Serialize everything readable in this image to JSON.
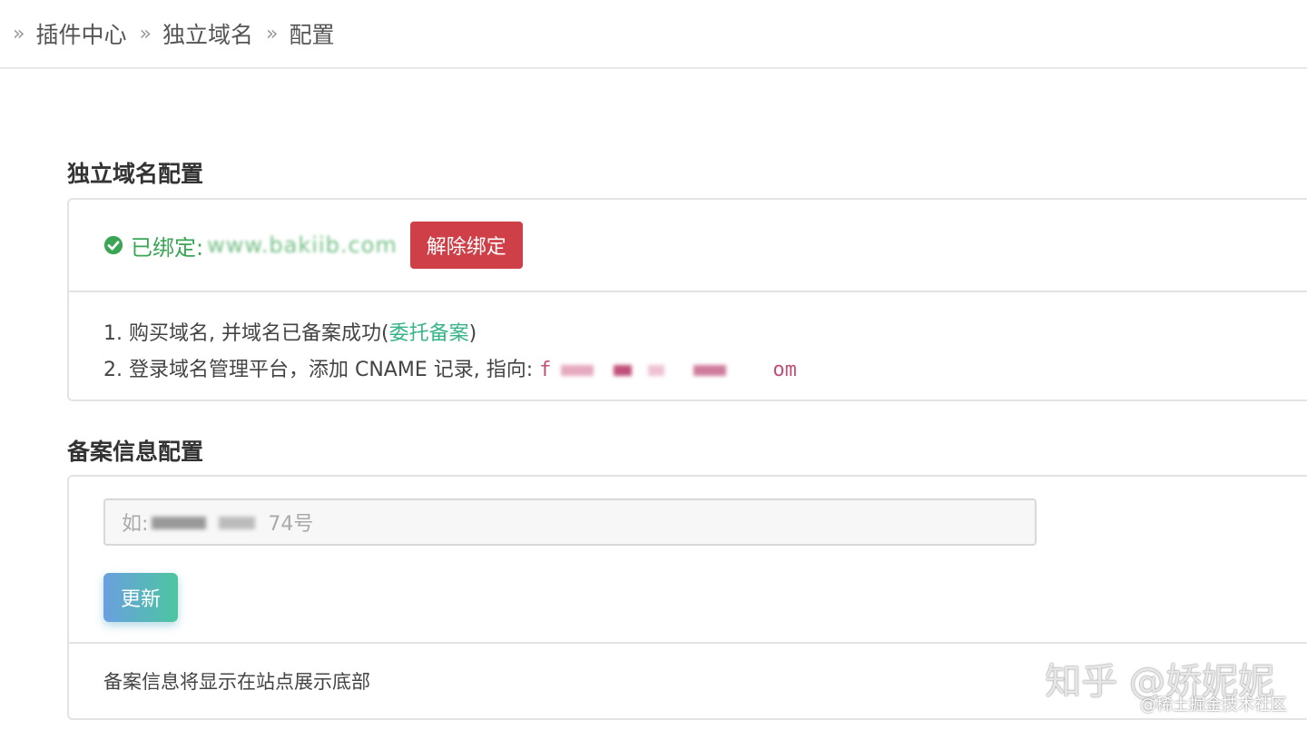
{
  "breadcrumb": {
    "items": [
      "插件中心",
      "独立域名",
      "配置"
    ],
    "separator": "»"
  },
  "domain_section": {
    "title": "独立域名配置",
    "bound_label": "已绑定:",
    "bound_domain": "www.bakiib.com",
    "unbind_label": "解除绑定",
    "step1_text": "1. 购买域名, 并域名已备案成功(",
    "step1_link": "委托备案",
    "step1_end": ")",
    "step2_text": "2. 登录域名管理平台，添加 CNAME 记录, 指向:",
    "step2_target_start": "f",
    "step2_target_end": "om"
  },
  "icp_section": {
    "title": "备案信息配置",
    "input_placeholder_start": "如: ",
    "input_placeholder_end": "74号",
    "update_label": "更新",
    "note": "备案信息将显示在站点展示底部"
  },
  "watermark": {
    "main": "知乎 @娇妮妮",
    "sub": "@稀土掘金技术社区"
  },
  "colors": {
    "success": "#3aa655",
    "danger": "#cf3f47",
    "link": "#38b48b",
    "cname": "#c0507a"
  }
}
